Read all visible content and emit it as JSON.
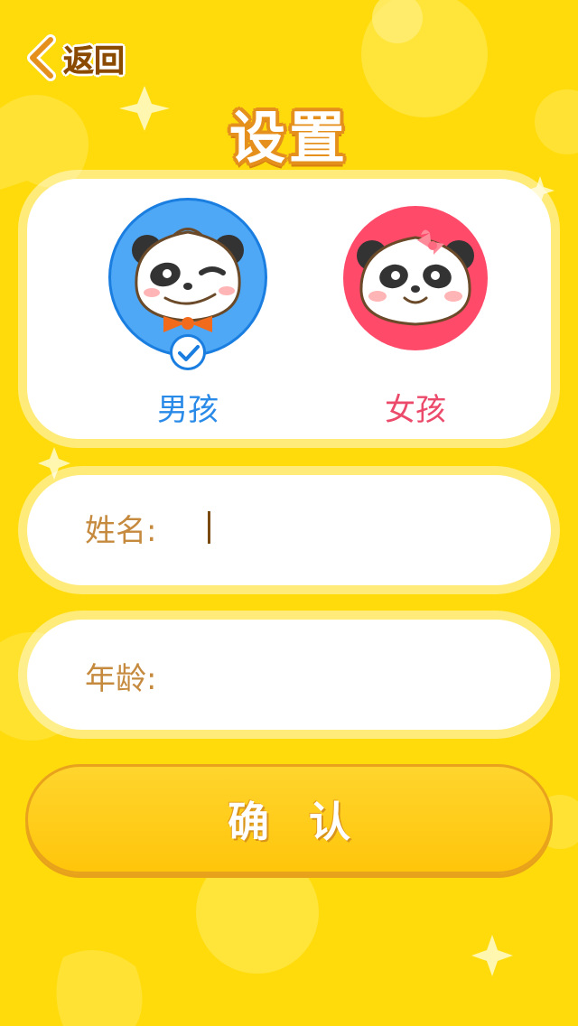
{
  "header": {
    "back_label": "返回",
    "title": "设置"
  },
  "gender": {
    "selected": "boy",
    "options": [
      {
        "id": "boy",
        "label": "男孩",
        "color": "#4EA8F6"
      },
      {
        "id": "girl",
        "label": "女孩",
        "color": "#FF4A6A"
      }
    ]
  },
  "form": {
    "name_label": "姓名:",
    "name_value": "",
    "age_label": "年龄:",
    "age_value": ""
  },
  "confirm": {
    "label": "确认"
  },
  "colors": {
    "background": "#FFDB0C",
    "title_outline": "#E5901D",
    "button": "#FFCC1A"
  }
}
